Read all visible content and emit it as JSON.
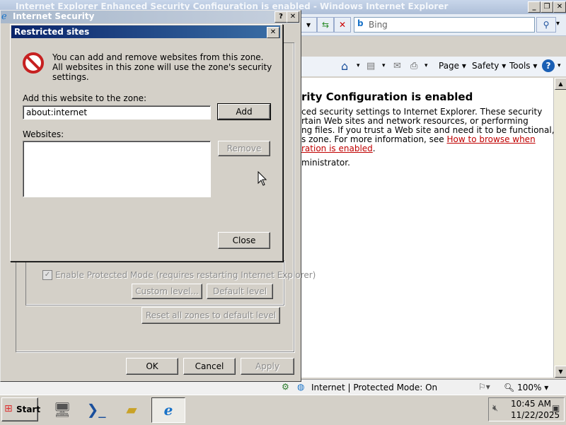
{
  "ie": {
    "title": "Internet Explorer Enhanced Security Configuration is enabled - Windows Internet Explorer",
    "search_placeholder": "Bing",
    "commands": [
      "Page",
      "Safety",
      "Tools"
    ],
    "content": {
      "heading": "rity Configuration is enabled",
      "line1": "ced security settings to Internet Explorer. These security",
      "line2": "rtain Web sites and network resources, or performing",
      "line3": "ng files. If you trust a Web site and need it to be functional,",
      "line4a": "s zone. For more information, see ",
      "link1": "How to browse when",
      "link2": "ration is enabled",
      "line5tail": ".",
      "line6": "ministrator."
    },
    "status": {
      "zone": "Internet | Protected Mode: On",
      "zoom": "100%"
    }
  },
  "internet_security": {
    "title": "Internet Security",
    "protected_mode_label": "Enable Protected Mode (requires restarting Internet Explorer)",
    "custom_level": "Custom level...",
    "default_level": "Default level",
    "reset_all": "Reset all zones to default level",
    "ok": "OK",
    "cancel": "Cancel",
    "apply": "Apply"
  },
  "restricted_sites": {
    "title": "Restricted sites",
    "info": "You can add and remove websites from this zone. All websites in this zone will use the zone's security settings.",
    "add_label": "Add this website to the zone:",
    "add_value": "about:internet",
    "add_button": "Add",
    "websites_label": "Websites:",
    "remove_button": "Remove",
    "close_button": "Close"
  },
  "taskbar": {
    "start": "Start",
    "time": "10:45 AM",
    "date": "11/22/2025"
  },
  "colors": {
    "title_active": "#0a246a",
    "link": "#c00000"
  }
}
